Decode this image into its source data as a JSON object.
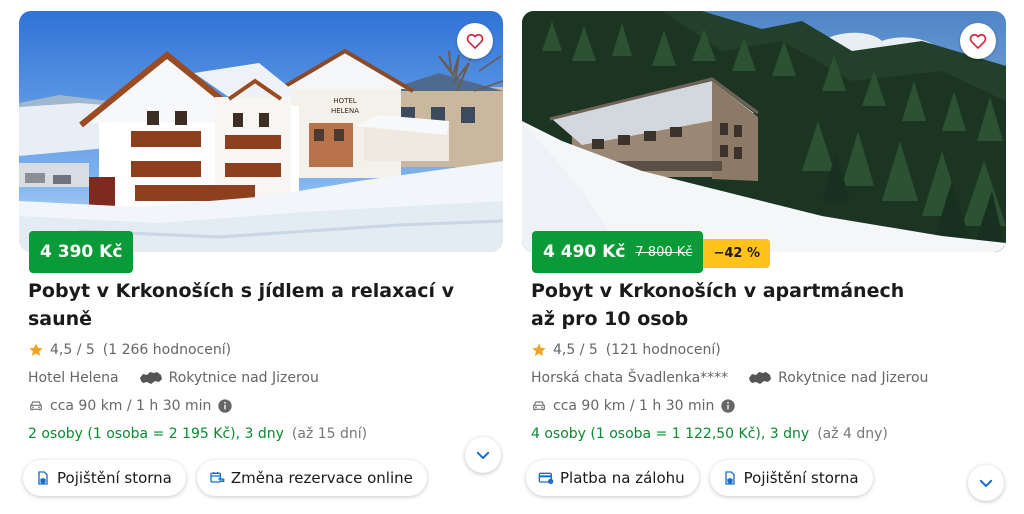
{
  "colors": {
    "price_green": "#0a9a37",
    "discount_yellow": "#ffc21a",
    "stay_green": "#0a8a2f",
    "accent_blue": "#1a6fc9",
    "star": "#f0a323"
  },
  "cards": [
    {
      "price": "4 390 Kč",
      "title": "Pobyt v Krkonoších s jídlem a relaxací v sauně",
      "rating": {
        "score": "4,5 / 5",
        "count": "(1 266 hodnocení)"
      },
      "hotel": "Hotel Helena",
      "location": "Rokytnice nad Jizerou",
      "distance": "cca 90 km / 1 h 30 min",
      "stay": "2 osoby (1 osoba = 2 195 Kč), 3 dny",
      "stay_range": "(až 15 dní)",
      "chips": [
        "Pojištění storna",
        "Změna rezervace online"
      ],
      "icons": {
        "favorite": "heart-icon",
        "expand": "chevron-down-icon"
      }
    },
    {
      "price": "4 490 Kč",
      "old_price": "7 800 Kč",
      "discount": "−42 %",
      "title": "Pobyt v Krkonoších v apartmánech až pro 10 osob",
      "rating": {
        "score": "4,5 / 5",
        "count": "(121 hodnocení)"
      },
      "hotel": "Horská chata Švadlenka****",
      "location": "Rokytnice nad Jizerou",
      "distance": "cca 90 km / 1 h 30 min",
      "stay": "4 osoby (1 osoba = 1 122,50 Kč), 3 dny",
      "stay_range": "(až 4 dny)",
      "chips": [
        "Platba na zálohu",
        "Pojištění storna"
      ],
      "icons": {
        "favorite": "heart-icon",
        "expand": "chevron-down-icon"
      }
    }
  ]
}
